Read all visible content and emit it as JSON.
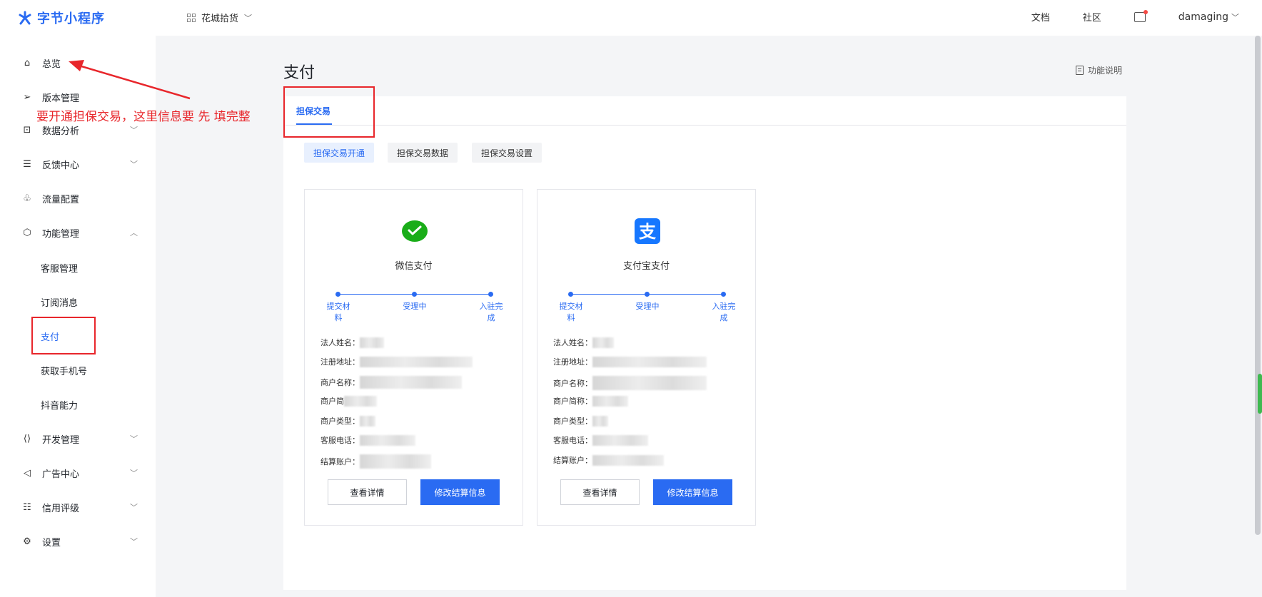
{
  "header": {
    "logo_text": "字节小程序",
    "app_name": "花城拾货",
    "docs_link": "文档",
    "community_link": "社区",
    "username": "damaging"
  },
  "sidebar": {
    "items": [
      {
        "label": "总览",
        "icon": "home-icon"
      },
      {
        "label": "版本管理",
        "icon": "send-icon"
      },
      {
        "label": "数据分析",
        "icon": "chart-icon"
      },
      {
        "label": "反馈中心",
        "icon": "message-icon"
      },
      {
        "label": "流量配置",
        "icon": "flow-icon"
      },
      {
        "label": "功能管理",
        "icon": "cube-icon"
      },
      {
        "label": "开发管理",
        "icon": "code-icon"
      },
      {
        "label": "广告中心",
        "icon": "megaphone-icon"
      },
      {
        "label": "信用评级",
        "icon": "list-icon"
      },
      {
        "label": "设置",
        "icon": "settings-icon"
      }
    ],
    "sub_items": [
      "客服管理",
      "订阅消息",
      "支付",
      "获取手机号",
      "抖音能力"
    ]
  },
  "annotation": "要开通担保交易，这里信息要 先 填完整",
  "main": {
    "title": "支付",
    "func_desc": "功能说明",
    "tab": "担保交易",
    "pills": [
      "担保交易开通",
      "担保交易数据",
      "担保交易设置"
    ],
    "cards": [
      {
        "name": "微信支付",
        "icon": "wechat-pay-icon",
        "steps": [
          "提交材料",
          "受理中",
          "入驻完成"
        ],
        "fields": [
          "法人姓名：",
          "注册地址：",
          "商户名称：",
          "商户简",
          "商户类型：",
          "客服电话：",
          "结算账户："
        ],
        "view_btn": "查看详情",
        "edit_btn": "修改结算信息"
      },
      {
        "name": "支付宝支付",
        "icon": "alipay-icon",
        "steps": [
          "提交材料",
          "受理中",
          "入驻完成"
        ],
        "fields": [
          "法人姓名：",
          "注册地址：",
          "商户名称：",
          "商户简称：",
          "商户类型：",
          "客服电话：",
          "结算账户："
        ],
        "view_btn": "查看详情",
        "edit_btn": "修改结算信息"
      }
    ]
  },
  "colors": {
    "accent": "#2a6bf2",
    "annotation": "#e8262b",
    "wechat": "#1aad19",
    "alipay": "#1677ff"
  }
}
